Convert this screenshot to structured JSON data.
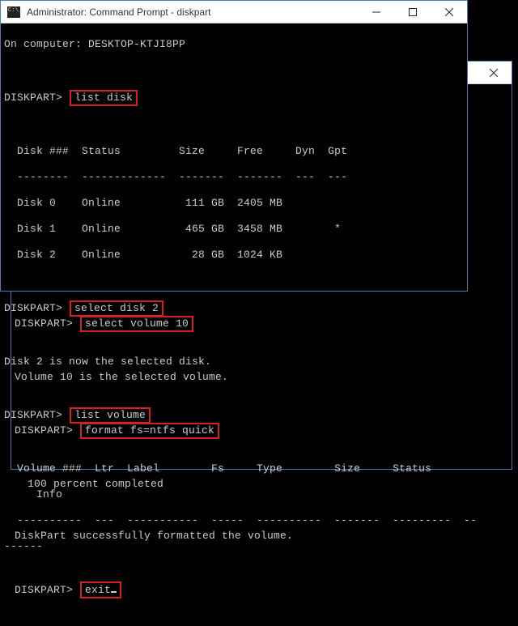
{
  "front_window": {
    "title": "Administrator: Command Prompt - diskpart",
    "lines": {
      "l1": "On computer: DESKTOP-KTJI8PP",
      "l2": "",
      "l3_prompt": "DISKPART>",
      "l3_cmd": "list disk",
      "l4": "",
      "l5": "  Disk ###  Status         Size     Free     Dyn  Gpt",
      "l6": "  --------  -------------  -------  -------  ---  ---",
      "l7": "  Disk 0    Online          111 GB  2405 MB",
      "l8": "  Disk 1    Online          465 GB  3458 MB        *",
      "l9": "  Disk 2    Online           28 GB  1024 KB",
      "l10": "",
      "l11_prompt": "DISKPART>",
      "l11_cmd": "select disk 2",
      "l12": "",
      "l13": "Disk 2 is now the selected disk.",
      "l14": "",
      "l15_prompt": "DISKPART>",
      "l15_cmd": "list volume",
      "l16": "",
      "l17": "  Volume ###  Ltr  Label        Fs     Type        Size     Status",
      "l17b": "     Info",
      "l18": "  ----------  ---  -----------  -----  ----------  -------  ---------  --",
      "l18b": "------"
    }
  },
  "back_window": {
    "title": "",
    "lines": {
      "l1_prompt": "DISKPART>",
      "l1_cmd": "select volume 10",
      "l2": "",
      "l3": "Volume 10 is the selected volume.",
      "l4": "",
      "l5_prompt": "DISKPART>",
      "l5_cmd": "format fs=ntfs quick",
      "l6": "",
      "l7": "  100 percent completed",
      "l8": "",
      "l9": "DiskPart successfully formatted the volume.",
      "l10": "",
      "l11_prompt": "DISKPART>",
      "l11_cmd": "exit"
    }
  }
}
